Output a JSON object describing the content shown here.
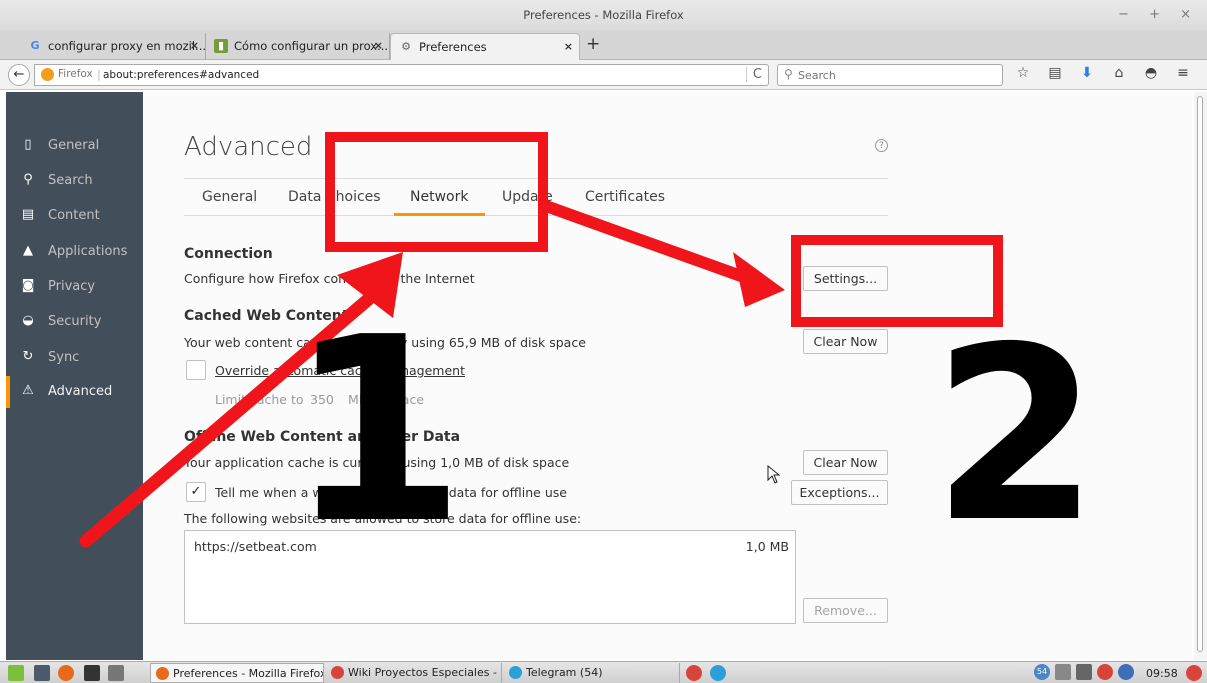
{
  "window": {
    "title": "Preferences - Mozilla Firefox",
    "controls": "− + ×"
  },
  "tabs": [
    {
      "label": "configurar proxy en mozil...",
      "icon": "google-icon",
      "close": "×"
    },
    {
      "label": "Cómo configurar un prox...",
      "icon": "site-favicon",
      "close": "×"
    },
    {
      "label": "Preferences",
      "icon": "gear-icon",
      "close": "×"
    }
  ],
  "new_tab": "+",
  "navbar": {
    "back": "←",
    "identity": "Firefox",
    "url": "about:preferences#advanced",
    "reload": "C",
    "search_placeholder": "Search",
    "toolbar_icons": [
      "☆",
      "▤",
      "⬇",
      "⌂",
      "◓",
      "≡"
    ]
  },
  "sidebar": {
    "items": [
      {
        "label": "General",
        "icon": "general-icon",
        "glyph": "▯"
      },
      {
        "label": "Search",
        "icon": "search-icon",
        "glyph": "⚲"
      },
      {
        "label": "Content",
        "icon": "content-icon",
        "glyph": "▤"
      },
      {
        "label": "Applications",
        "icon": "applications-icon",
        "glyph": "▲"
      },
      {
        "label": "Privacy",
        "icon": "privacy-icon",
        "glyph": "◙"
      },
      {
        "label": "Security",
        "icon": "security-icon",
        "glyph": "◒"
      },
      {
        "label": "Sync",
        "icon": "sync-icon",
        "glyph": "↻"
      },
      {
        "label": "Advanced",
        "icon": "advanced-icon",
        "glyph": "⚠"
      }
    ],
    "selected": "Advanced"
  },
  "main": {
    "title": "Advanced",
    "help": "?",
    "subtabs": [
      "General",
      "Data Choices",
      "Network",
      "Update",
      "Certificates"
    ],
    "active_subtab": "Network",
    "connection": {
      "heading": "Connection",
      "desc": "Configure how Firefox connects to the Internet",
      "button": "Settings..."
    },
    "cache": {
      "heading": "Cached Web Content",
      "desc": "Your web content cache is currently using 65,9 MB of disk space",
      "button": "Clear Now",
      "override_label": "Override automatic cache management",
      "override_checked": false,
      "limit_label": "Limit cache to",
      "limit_value": "350",
      "limit_unit": "MB of space"
    },
    "offline": {
      "heading": "Offline Web Content and User Data",
      "desc": "Your application cache is currently using 1,0 MB of disk space",
      "clear_button": "Clear Now",
      "tell_me_label": "Tell me when a website asks to store data for offline use",
      "tell_me_checked": true,
      "check_glyph": "✓",
      "exceptions_button": "Exceptions...",
      "list_label": "The following websites are allowed to store data for offline use:",
      "sites": [
        {
          "site": "https://setbeat.com",
          "size": "1,0 MB"
        }
      ],
      "remove_button": "Remove..."
    }
  },
  "annotations": {
    "number1": "1",
    "number2": "2",
    "color": "#f0141b"
  },
  "taskbar": {
    "tasks": [
      {
        "label": "Preferences - Mozilla Firefox",
        "active": true
      },
      {
        "label": "Wiki Proyectos Especiales - p...",
        "active": false
      },
      {
        "label": "Telegram (54)",
        "active": false
      }
    ],
    "tray_badge": "54",
    "clock": "09:58"
  }
}
